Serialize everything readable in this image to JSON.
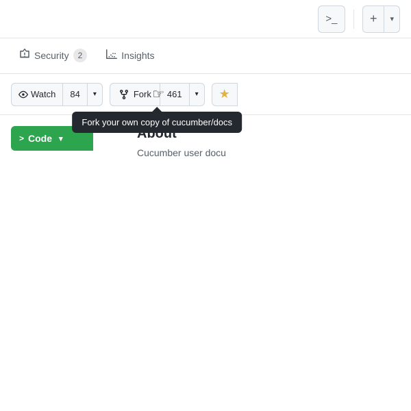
{
  "topbar": {
    "terminal_icon": ">_",
    "plus_icon": "+",
    "chevron_down": "▾"
  },
  "nav": {
    "tabs": [
      {
        "id": "security",
        "label": "Security",
        "icon": "⚠",
        "badge": "2",
        "active": false
      },
      {
        "id": "insights",
        "label": "Insights",
        "icon": "📈",
        "badge": null,
        "active": false
      }
    ]
  },
  "actionbar": {
    "watch_label": "Watch",
    "watch_count": "84",
    "fork_label": "Fork",
    "fork_count": "461",
    "star_icon": "★"
  },
  "tooltip": {
    "text": "Fork your own copy of cucumber/docs"
  },
  "content": {
    "code_label": "Code",
    "code_arrow": "▾",
    "about_title": "About",
    "about_text": "Cucumber user docu"
  }
}
